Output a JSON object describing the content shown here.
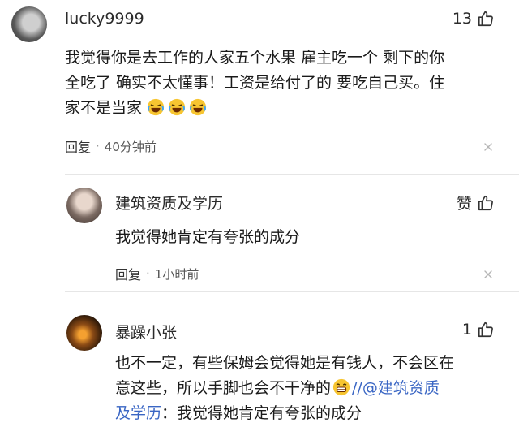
{
  "comments": [
    {
      "username": "lucky9999",
      "likes": "13",
      "text_lines": [
        "我觉得你是去工作的人家五个水果 雇主吃一个 剩下的你",
        "全吃了 确实不太懂事！工资是给付了的 要吃自己买。住",
        "家不是当家"
      ],
      "reply_label": "回复",
      "time": "40分钟前"
    },
    {
      "username": "建筑资质及学历",
      "likes": "赞",
      "text": "我觉得她肯定有夸张的成分",
      "reply_label": "回复",
      "time": "1小时前"
    },
    {
      "username": "暴躁小张",
      "likes": "1",
      "text_line1": "也不一定，有些保姆会觉得她是有钱人，不会区在",
      "text_line2_a": "意这些，所以手脚也会不干净的",
      "text_line2_link": "//@建筑资质",
      "text_line3_link": "及学历",
      "text_line3_b": "：我觉得她肯定有夸张的成分"
    }
  ],
  "icons": {
    "thumb": "thumbs-up-icon",
    "close": "close-icon",
    "laugh_emoji": "laughing-crying-emoji",
    "grin_emoji": "grinning-emoji"
  },
  "colors": {
    "link": "#3a66c4",
    "text": "#1a1a1a",
    "meta": "#555555"
  }
}
